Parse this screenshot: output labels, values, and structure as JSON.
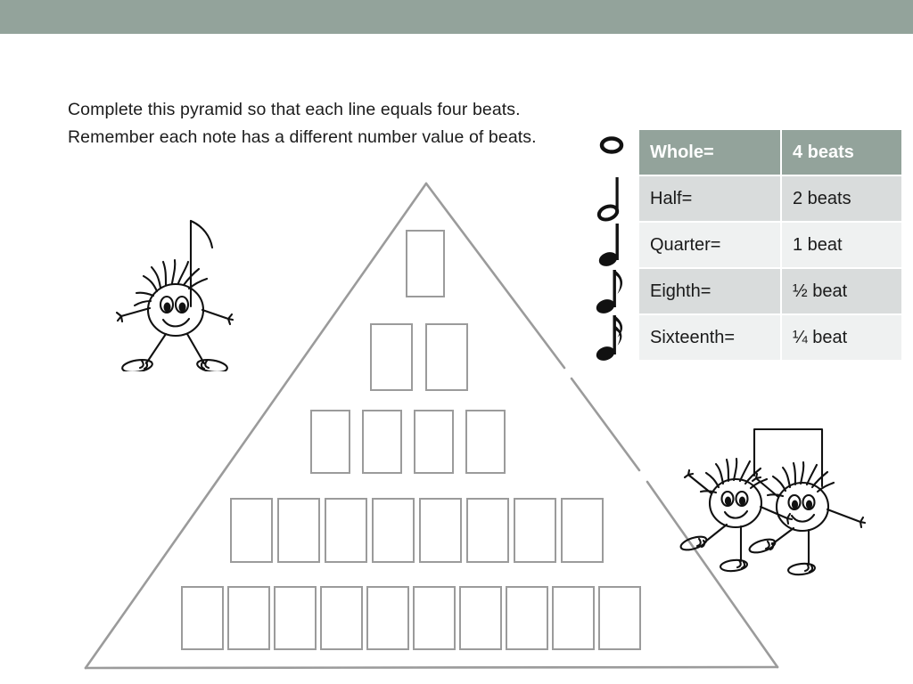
{
  "page": {
    "title": "Complete this pyramid so that each line equals four beats.",
    "band_color": "#93a39b",
    "background_color": "#ffffff"
  },
  "instructions": {
    "text": "Complete this pyramid so that each line equals four beats.  Remember each note has a different number value of beats."
  },
  "note_table": {
    "header_bg": "#93a39b",
    "row_dark_bg": "#d9dcdc",
    "row_light_bg": "#eff1f1",
    "rows": [
      {
        "icon": "whole-note-icon",
        "name": "Whole=",
        "value": "4 beats",
        "style": "header"
      },
      {
        "icon": "half-note-icon",
        "name": "Half=",
        "value": "2 beats",
        "style": "dark"
      },
      {
        "icon": "quarter-note-icon",
        "name": "Quarter=",
        "value": "1 beat",
        "style": "light"
      },
      {
        "icon": "eighth-note-icon",
        "name": "Eighth=",
        "value": "½ beat",
        "style": "dark"
      },
      {
        "icon": "sixteenth-note-icon",
        "name": "Sixteenth=",
        "value": "¼ beat",
        "style": "light"
      }
    ]
  },
  "pyramid": {
    "border_color": "#9b9b9b",
    "rows": [
      {
        "row": 1,
        "boxes": 1
      },
      {
        "row": 2,
        "boxes": 2
      },
      {
        "row": 3,
        "boxes": 4
      },
      {
        "row": 4,
        "boxes": 8
      },
      {
        "row": 5,
        "boxes": 10
      }
    ]
  },
  "doodles": [
    {
      "id": "eighth-note-character",
      "description": "hand-drawn smiling stick figure with spiky hair and an eighth-note flag"
    },
    {
      "id": "beamed-eighth-notes-characters",
      "description": "two hand-drawn smiling stick figures joined by a beam"
    }
  ]
}
